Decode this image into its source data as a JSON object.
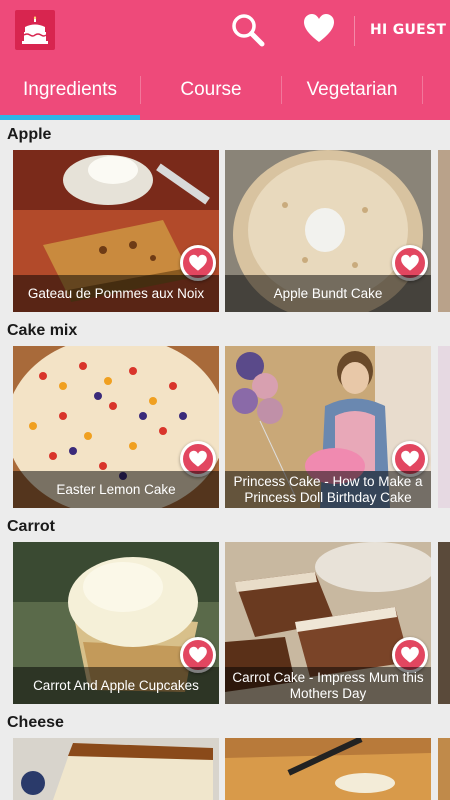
{
  "header": {
    "logo_icon": "cake-icon",
    "search_icon": "search-icon",
    "favorites_icon": "heart-icon",
    "user_label": "HI GUEST",
    "bar_color": "#ee4a7a",
    "logo_color": "#d8254f"
  },
  "tabs": {
    "items": [
      {
        "label": "Ingredients",
        "selected": true
      },
      {
        "label": "Course",
        "selected": false
      },
      {
        "label": "Vegetarian",
        "selected": false
      }
    ],
    "indicator_color": "#2fb5e6"
  },
  "sections": [
    {
      "title": "Apple",
      "cards": [
        {
          "title": "Gateau de Pommes aux Noix"
        },
        {
          "title": "Apple Bundt Cake"
        }
      ]
    },
    {
      "title": "Cake mix",
      "cards": [
        {
          "title": "Easter Lemon Cake"
        },
        {
          "title": "Princess Cake - How to Make a Princess Doll Birthday Cake"
        }
      ]
    },
    {
      "title": "Carrot",
      "cards": [
        {
          "title": "Carrot And Apple Cupcakes"
        },
        {
          "title": "Carrot Cake - Impress Mum this Mothers Day"
        }
      ]
    },
    {
      "title": "Cheese",
      "cards": []
    }
  ],
  "favorite_button_icon": "heart-icon"
}
